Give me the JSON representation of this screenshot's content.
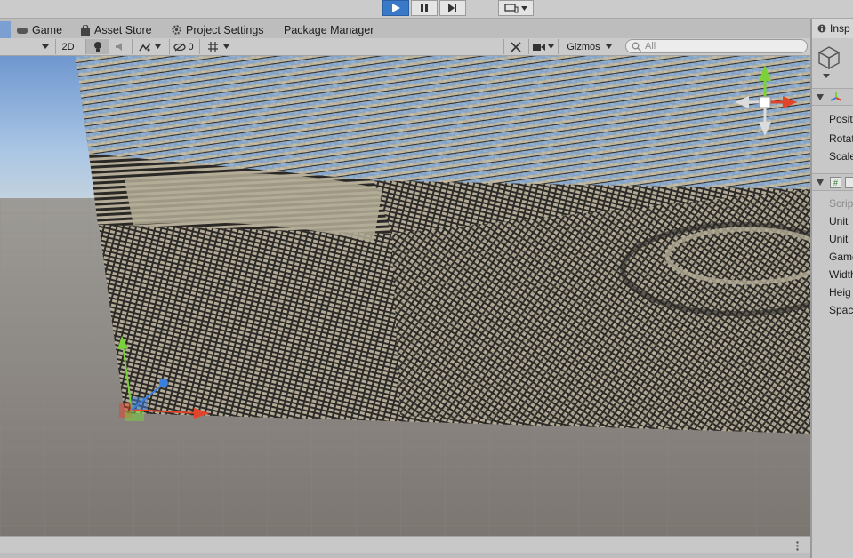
{
  "toolbar": {
    "play_icon": "play-icon",
    "pause_icon": "pause-icon",
    "step_icon": "step-icon",
    "device_icon": "device-icon"
  },
  "tabs": [
    {
      "label": "Game",
      "icon": "game-icon"
    },
    {
      "label": "Asset Store",
      "icon": "shopping-bag-icon"
    },
    {
      "label": "Project Settings",
      "icon": "gear-icon"
    },
    {
      "label": "Package Manager",
      "icon": ""
    }
  ],
  "scene_toolbar": {
    "mode_2d": "2D",
    "hidden_count": "0",
    "gizmos_label": "Gizmos",
    "search_placeholder": "All"
  },
  "inspector": {
    "tab_label": "Insp",
    "transform_fields": [
      "Posit",
      "Rotat",
      "Scale"
    ],
    "script_fields": {
      "script": "Scrip",
      "rows": [
        "Unit",
        "Unit",
        "Game",
        "Width",
        "Heig",
        "Spac"
      ]
    }
  },
  "colors": {
    "accent_play": "#3a78c8",
    "axis_x": "#e0442a",
    "axis_y": "#7ad13a",
    "axis_z": "#3a7fe0",
    "mesh": "#b3ab96"
  }
}
